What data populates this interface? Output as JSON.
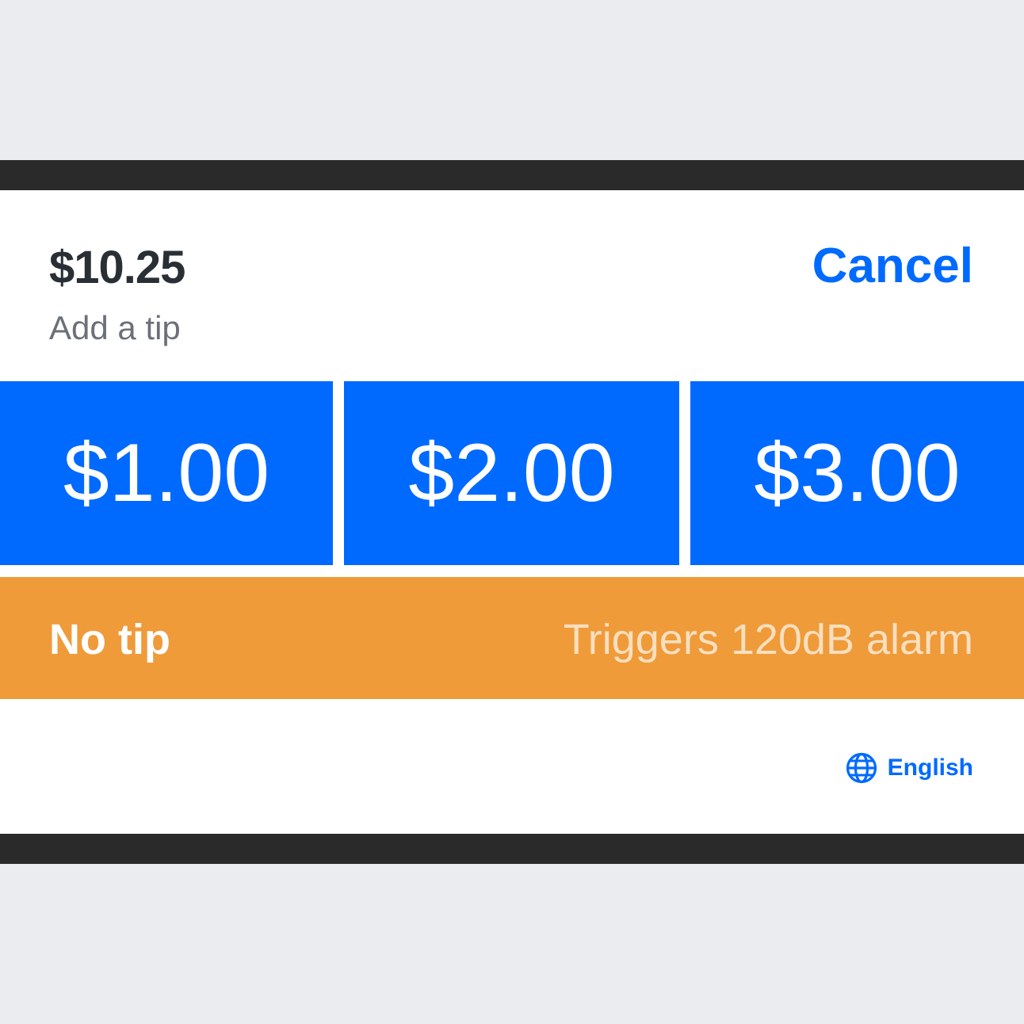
{
  "header": {
    "total": "$10.25",
    "subtitle": "Add a tip",
    "cancel_label": "Cancel"
  },
  "tip_options": [
    {
      "label": "$1.00"
    },
    {
      "label": "$2.00"
    },
    {
      "label": "$3.00"
    }
  ],
  "no_tip": {
    "label": "No tip",
    "note": "Triggers 120dB alarm"
  },
  "footer": {
    "language_icon": "globe-icon",
    "language_label": "English"
  },
  "colors": {
    "accent": "#006aff",
    "no_tip_bg": "#ef9b3a",
    "bezel": "#2a2a2a",
    "background": "#ebecef"
  }
}
